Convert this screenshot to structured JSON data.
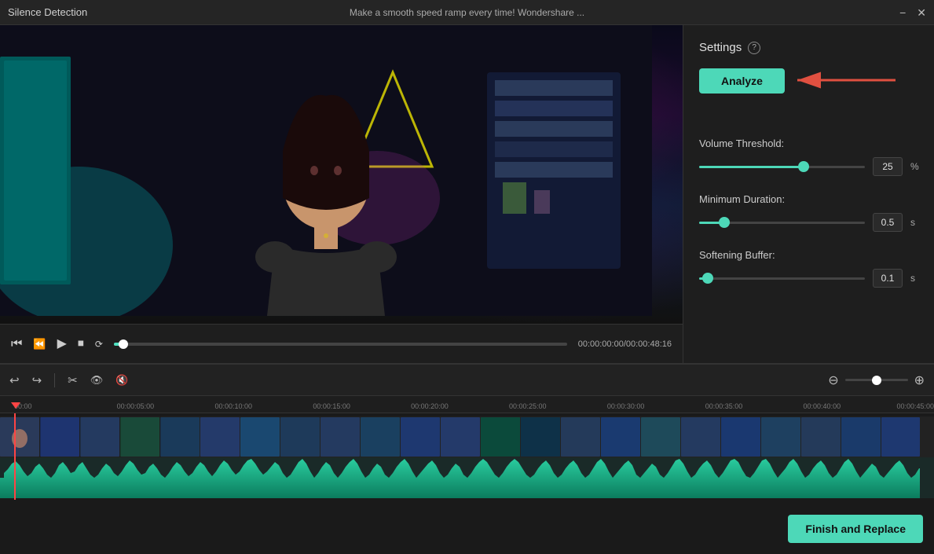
{
  "titleBar": {
    "title": "Silence Detection",
    "centerText": "Make a smooth speed ramp every time!  Wondershare ...",
    "minimizeLabel": "−",
    "closeLabel": "✕"
  },
  "settings": {
    "title": "Settings",
    "helpIcon": "?",
    "analyzeLabel": "Analyze",
    "volumeThreshold": {
      "label": "Volume Threshold:",
      "value": "25",
      "unit": "%",
      "fillPercent": 63
    },
    "minimumDuration": {
      "label": "Minimum Duration:",
      "value": "0.5",
      "unit": "s",
      "fillPercent": 15
    },
    "softeningBuffer": {
      "label": "Softening Buffer:",
      "value": "0.1",
      "unit": "s",
      "fillPercent": 5
    }
  },
  "videoControls": {
    "timeDisplay": "00:00:00:00/00:00:48:16"
  },
  "timeline": {
    "rulerMarks": [
      {
        "label": "00:00",
        "leftPercent": 0
      },
      {
        "label": "00:00:05:00",
        "leftPercent": 10.4
      },
      {
        "label": "00:00:10:00",
        "leftPercent": 20.7
      },
      {
        "label": "00:00:15:00",
        "leftPercent": 31.1
      },
      {
        "label": "00:00:20:00",
        "leftPercent": 41.5
      },
      {
        "label": "00:00:25:00",
        "leftPercent": 51.8
      },
      {
        "label": "00:00:30:00",
        "leftPercent": 62.2
      },
      {
        "label": "00:00:35:00",
        "leftPercent": 72.5
      },
      {
        "label": "00:00:40:00",
        "leftPercent": 82.9
      },
      {
        "label": "00:00:45:00",
        "leftPercent": 93.2
      }
    ]
  },
  "buttons": {
    "finishAndReplace": "Finish and Replace"
  }
}
